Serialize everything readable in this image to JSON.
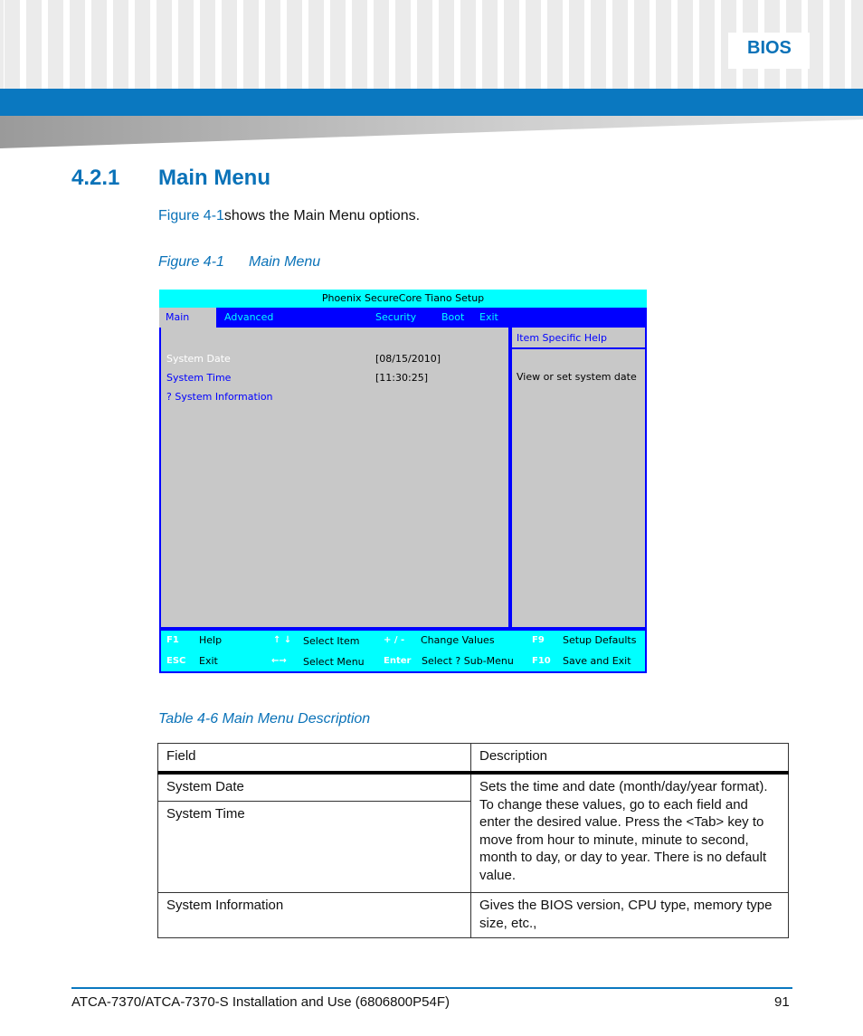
{
  "header": {
    "section": "BIOS"
  },
  "section": {
    "number": "4.2.1",
    "title": "Main Menu"
  },
  "intro": {
    "link": "Figure 4-1",
    "text": "shows the Main Menu options."
  },
  "figure": {
    "label": "Figure 4-1",
    "title": "Main Menu"
  },
  "bios": {
    "title": "Phoenix SecureCore Tiano Setup",
    "menu": [
      "Main",
      "Advanced",
      "Security",
      "Boot",
      "Exit"
    ],
    "rows": [
      {
        "label": "System Date",
        "value": "[08/15/2010]"
      },
      {
        "label": "System Time",
        "value": "[11:30:25]"
      },
      {
        "label": "? System Information",
        "value": ""
      }
    ],
    "help_title": "Item Specific Help",
    "help_text": "View or set system date",
    "footer": [
      {
        "key": "F1",
        "text": "Help"
      },
      {
        "key": "ESC",
        "text": "Exit"
      },
      {
        "key": "↑ ↓",
        "text": "Select Item"
      },
      {
        "key": "←→",
        "text": "Select Menu"
      },
      {
        "key": "+ / -",
        "text": "Change Values"
      },
      {
        "key": "Enter",
        "text": "Select ? Sub-Menu"
      },
      {
        "key": "F9",
        "text": "Setup Defaults"
      },
      {
        "key": "F10",
        "text": "Save and Exit"
      }
    ],
    "colors": {
      "cyan": "#00ffff",
      "blue": "#0000ff",
      "gray": "#c8c8c8"
    }
  },
  "table": {
    "caption": "Table 4-6 Main Menu Description",
    "headers": [
      "Field",
      "Description"
    ],
    "rows": [
      {
        "field": "System Date",
        "description": "Sets the time and date (month/day/year format). To change these values, go to each field and enter the desired value. Press the <Tab> key to move from hour to minute, minute to second, month to day, or day to year. There is no default value."
      },
      {
        "field": "System Time"
      },
      {
        "field": "System Information",
        "description": "Gives the BIOS version, CPU type, memory type size, etc.,"
      }
    ]
  },
  "footer": {
    "doc": "ATCA-7370/ATCA-7370-S Installation and Use (6806800P54F)",
    "page": "91"
  }
}
